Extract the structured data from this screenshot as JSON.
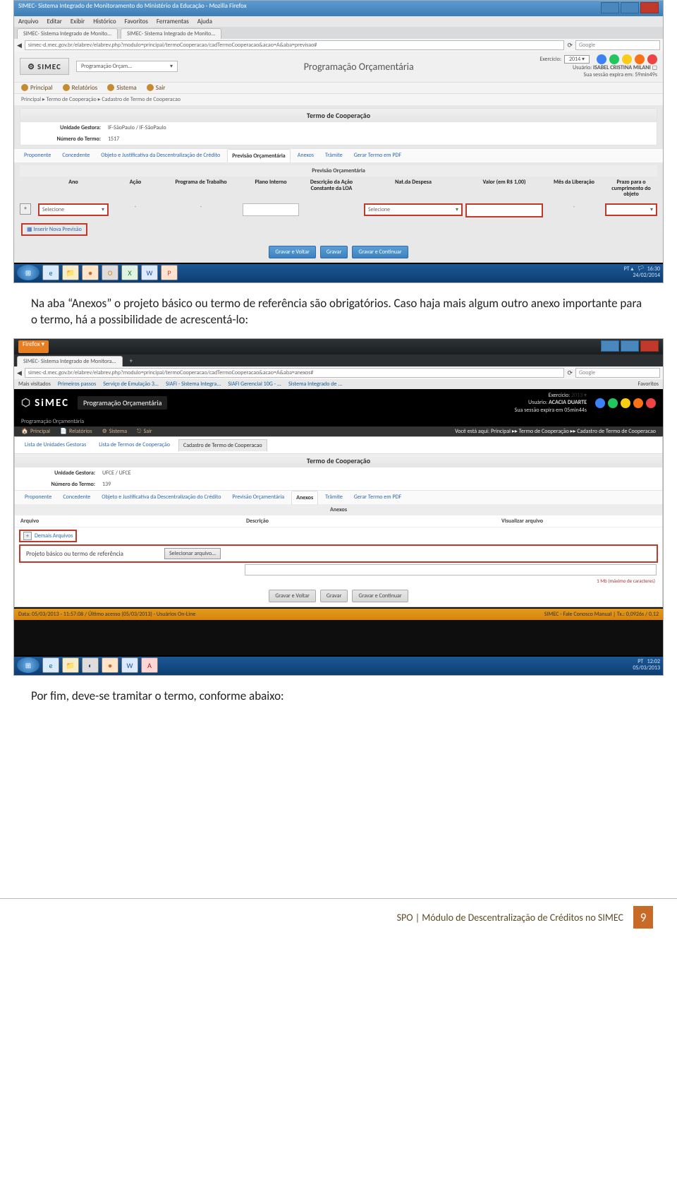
{
  "shot1": {
    "win_title": "SIMEC- Sistema Integrado de Monitoramento do Ministério da Educação - Mozilla Firefox",
    "menu": [
      "Arquivo",
      "Editar",
      "Exibir",
      "Histórico",
      "Favoritos",
      "Ferramentas",
      "Ajuda"
    ],
    "tabs": [
      "SIMEC- Sistema Integrado de Monito...",
      "SIMEC- Sistema Integrado de Monito..."
    ],
    "url": "simec-d.mec.gov.br/elabrev/elabrev.php?modulo=principal/termoCooperacao/cadTermoCooperacao&acao=A&aba=previsao#",
    "search_ph": "Google",
    "logo": "SIMEC",
    "module": "Programação Orçam...",
    "chev": "▾",
    "center_title": "Programação Orçamentária",
    "exerc_lbl": "Exercício:",
    "exerc_val": "2014 ▾",
    "user_lbl": "Usuário:",
    "user_val": "ISABEL CRISTINA MILANI",
    "sess": "Sua sessão expira em: 59min49s",
    "nav": [
      "Principal",
      "Relatórios",
      "Sistema",
      "Sair"
    ],
    "breadcrumb": "Principal   ▸   Termo de Cooperação   ▸   Cadastro de Termo de Cooperacao",
    "panel_title": "Termo de Cooperação",
    "kv1_k": "Unidade Gestora:",
    "kv1_v": "IF-SãoPaulo / IF-SãoPaulo",
    "kv2_k": "Número do Termo:",
    "kv2_v": "1517",
    "subtabs": [
      "Proponente",
      "Concedente",
      "Objeto e Justificativa da Descentralização de Crédito",
      "Previsão Orçamentária",
      "Anexos",
      "Trâmite",
      "Gerar Termo em PDF"
    ],
    "active_subtab": "Previsão Orçamentária",
    "section": "Previsão Orçamentária",
    "th": [
      "",
      "Ano",
      "Ação",
      "Programa de Trabalho",
      "Plano Interno",
      "Descrição da Ação Constante da LOA",
      "Nat.da Despesa",
      "Valor (em R$ 1,00)",
      "Mês da Liberação",
      "Prazo para o cumprimento do objeto"
    ],
    "sel_ph": "Selecione",
    "dash": "-",
    "add_link": "Inserir Nova Previsão",
    "btns": [
      "Gravar e Voltar",
      "Gravar",
      "Gravar e Continuar"
    ],
    "tray_lang": "PT ▴",
    "tray_time": "16:30",
    "tray_date": "24/02/2014",
    "plus": "+"
  },
  "para1": "Na aba “Anexos” o projeto básico ou termo de referência são obrigatórios. Caso haja mais algum outro anexo importante para o termo, há a possibilidade de acrescentá-lo:",
  "shot2": {
    "url": "simec-d.mec.gov.br/elabrev/elabrev.php?modulo=principal/termoCooperacao/cadTermoCooperacao&acao=A&aba=anexos#",
    "tab": "SIMEC- Sistema Integrado de Monitora...",
    "bm_lbl": "Mais visitados",
    "bm1": "Primeiros passos",
    "bm2": "Serviço de Emulação 3...",
    "bm3": "SIAFI - Sistema Integra...",
    "bm4": "SIAFI Gerencial 10G - ...",
    "bm5": "Sistema Integrado de ...",
    "bm_fav": "Favoritos",
    "logo": "SiMEC",
    "module": "Programação Orçamentária",
    "exerc_lbl": "Exercício:",
    "exerc_val": "2013 ▾",
    "user_lbl": "Usuário:",
    "user_val": "ACACIA DUARTE",
    "sess": "Sua sessão expira em 05min44s",
    "dark_sub": "Programação Orçamentária",
    "nav": [
      "Principal",
      "Relatórios",
      "Sistema",
      "Sair"
    ],
    "bc": "Você está aqui: Principal ▸▸ Termo de Cooperação ▸▸ Cadastro de Termo de Cooperacao",
    "headertabs": [
      "Lista de Unidades Gestoras",
      "Lista de Termos de Cooperação",
      "Cadastro de Termo de Cooperacao"
    ],
    "panel_title": "Termo de Cooperação",
    "kv1_k": "Unidade Gestora:",
    "kv1_v": "UFCE / UFCE",
    "kv2_k": "Número do Termo:",
    "kv2_v": "139",
    "subtabs": [
      "Proponente",
      "Concedente",
      "Objeto e Justificativa da Descentralização do Crédito",
      "Previsão Orçamentária",
      "Anexos",
      "Trâmite",
      "Gerar Termo em PDF"
    ],
    "active_subtab": "Anexos",
    "section": "Anexos",
    "col_arq": "Arquivo",
    "col_desc": "Descrição",
    "col_vis": "Visualizar arquivo",
    "demais": "Demais Arquivos",
    "row_lab": "Projeto básico ou termo de referência",
    "file_btn": "Selecionar arquivo...",
    "max": "1 Mb (máximo de caracteres)",
    "btns": [
      "Gravar e Voltar",
      "Gravar",
      "Gravar e Continuar"
    ],
    "orange_left": "Data: 05/03/2013 - 11:57:08 / Último acesso (05/03/2013) - Usuários On-Line",
    "orange_right": "SIMEC - Fale Conosco Manual  | Tx.: 0,0926s / 0,12",
    "tray_lang": "PT",
    "tray_time": "12:02",
    "tray_date": "05/03/2013"
  },
  "para2": "Por fim, deve-se tramitar o termo, conforme abaixo:",
  "footer": {
    "text": "SPO | Módulo de Descentralização de Créditos no SIMEC",
    "page": "9"
  }
}
